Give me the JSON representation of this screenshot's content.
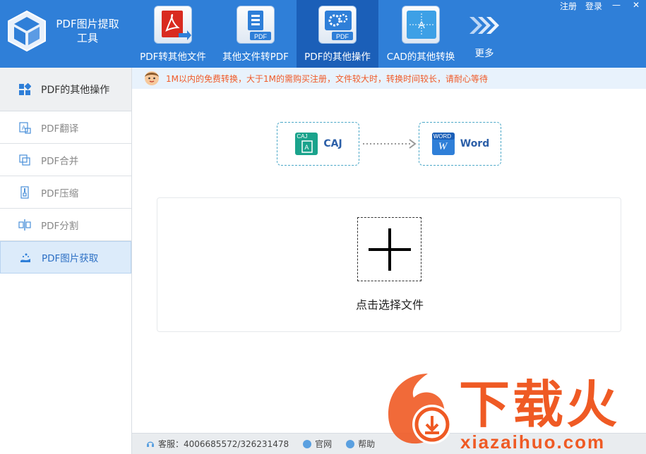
{
  "app": {
    "title": "PDF图片提取工具"
  },
  "window": {
    "register": "注册",
    "login": "登录",
    "minimize": "—",
    "close": "✕"
  },
  "nav": [
    {
      "label": "PDF转其他文件",
      "icon": "pdf-acrobat-icon"
    },
    {
      "label": "其他文件转PDF",
      "icon": "doc-to-pdf-icon"
    },
    {
      "label": "PDF的其他操作",
      "icon": "pdf-gear-icon",
      "active": true
    },
    {
      "label": "CAD的其他转换",
      "icon": "cad-icon"
    },
    {
      "label": "更多",
      "icon": "more-arrows-icon"
    }
  ],
  "sidebar": {
    "header": "PDF的其他操作",
    "items": [
      {
        "label": "PDF翻译",
        "icon": "translate-icon"
      },
      {
        "label": "PDF合并",
        "icon": "merge-icon"
      },
      {
        "label": "PDF压缩",
        "icon": "compress-icon"
      },
      {
        "label": "PDF分割",
        "icon": "split-icon"
      },
      {
        "label": "PDF图片获取",
        "icon": "image-extract-icon",
        "active": true
      }
    ]
  },
  "notice": {
    "text": "1M以内的免费转换，大于1M的需购买注册，文件较大时，转换时间较长，请耐心等待"
  },
  "conversion": {
    "from": {
      "label": "CAJ",
      "badge": "CAJ",
      "glyph": "A"
    },
    "to": {
      "label": "Word",
      "badge": "WORD",
      "glyph": "W"
    }
  },
  "upload": {
    "label": "点击选择文件"
  },
  "statusbar": {
    "service": "客服：4006685572/326231478",
    "website": "官网",
    "help": "帮助"
  },
  "watermark": {
    "text": "下载火",
    "url": "xiazaihuo.com"
  },
  "colors": {
    "header": "#2f7fd8",
    "active_nav": "#1b5fb8",
    "notice_text": "#f05a28",
    "watermark": "#ef5a24"
  }
}
